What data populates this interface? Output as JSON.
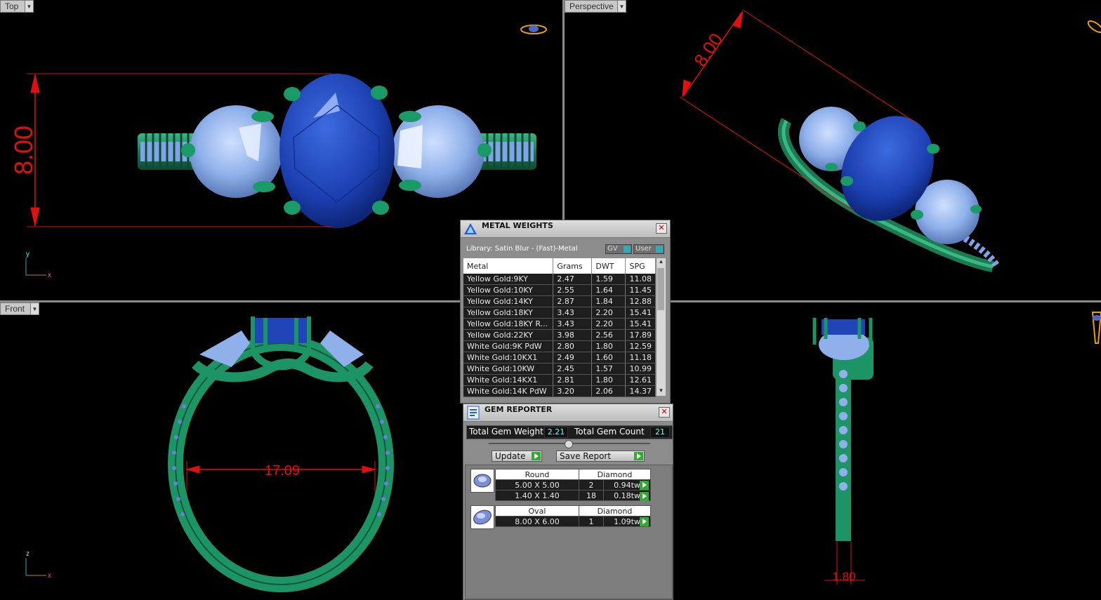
{
  "viewports": {
    "top": {
      "label": "Top",
      "dimension": "8.00",
      "axis_y": "y",
      "axis_x": "x"
    },
    "perspective": {
      "label": "Perspective",
      "dimension": "8.00"
    },
    "front": {
      "label": "Front",
      "dimension": "17.09",
      "axis_z": "z",
      "axis_x": "x"
    },
    "right": {
      "dimension": "1.80"
    }
  },
  "metal_weights": {
    "title": "METAL WEIGHTS",
    "library": "Library: Satin Blur - (Fast)-Metal",
    "toggle_gv": "GV",
    "toggle_user": "User",
    "columns": [
      "Metal",
      "Grams",
      "DWT",
      "SPG"
    ],
    "rows": [
      [
        "Yellow Gold:9KY",
        "2.47",
        "1.59",
        "11.08"
      ],
      [
        "Yellow Gold:10KY",
        "2.55",
        "1.64",
        "11.45"
      ],
      [
        "Yellow Gold:14KY",
        "2.87",
        "1.84",
        "12.88"
      ],
      [
        "Yellow Gold:18KY",
        "3.43",
        "2.20",
        "15.41"
      ],
      [
        "Yellow Gold:18KY R...",
        "3.43",
        "2.20",
        "15.41"
      ],
      [
        "Yellow Gold:22KY",
        "3.98",
        "2.56",
        "17.89"
      ],
      [
        "White Gold:9K PdW",
        "2.80",
        "1.80",
        "12.59"
      ],
      [
        "White Gold:10KX1",
        "2.49",
        "1.60",
        "11.18"
      ],
      [
        "White Gold:10KW",
        "2.45",
        "1.57",
        "10.99"
      ],
      [
        "White Gold:14KX1",
        "2.81",
        "1.80",
        "12.61"
      ],
      [
        "White Gold:14K PdW",
        "3.20",
        "2.06",
        "14.37"
      ]
    ]
  },
  "gem_reporter": {
    "title": "GEM REPORTER",
    "total_weight_label": "Total Gem Weight",
    "total_weight": "2.21",
    "total_count_label": "Total Gem Count",
    "total_count": "21",
    "update_label": "Update",
    "save_label": "Save Report",
    "groups": [
      {
        "shape": "Round",
        "material": "Diamond",
        "rows": [
          [
            "5.00 X 5.00",
            "2",
            "0.94tw"
          ],
          [
            "1.40 X 1.40",
            "18",
            "0.18tw"
          ]
        ]
      },
      {
        "shape": "Oval",
        "material": "Diamond",
        "rows": [
          [
            "8.00 X 6.00",
            "1",
            "1.09tw"
          ]
        ]
      }
    ]
  },
  "colors": {
    "metal": "#1f8a5e",
    "gem_center": "#1f45b8",
    "gem_side": "#8fb4ee",
    "dimension": "#e01010"
  }
}
